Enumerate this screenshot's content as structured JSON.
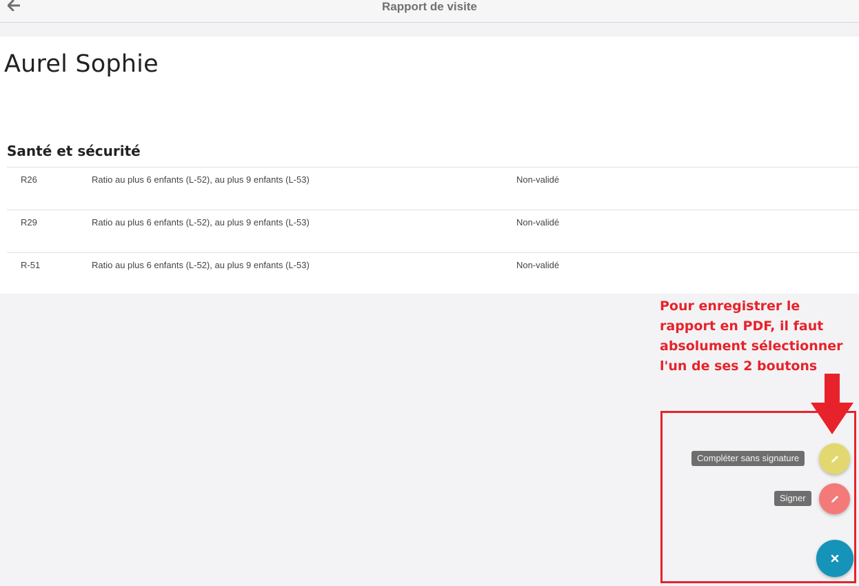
{
  "header": {
    "back_icon": "arrow-left-icon",
    "title": "Rapport de visite"
  },
  "report": {
    "person_name": "Aurel Sophie",
    "section_title": "Santé et sécurité",
    "rows": [
      {
        "code": "R26",
        "description": "Ratio au plus 6 enfants (L-52), au plus 9 enfants (L-53)",
        "status": "Non-validé"
      },
      {
        "code": "R29",
        "description": "Ratio au plus 6 enfants (L-52), au plus 9 enfants (L-53)",
        "status": "Non-validé"
      },
      {
        "code": "R-51",
        "description": "Ratio au plus 6 enfants (L-52), au plus 9 enfants (L-53)",
        "status": "Non-validé"
      }
    ]
  },
  "annotation": {
    "text": "Pour enregistrer le rapport en PDF, il faut absolument sélectionner l'un de ses 2 boutons",
    "color": "#e8222a",
    "arrow_icon": "arrow-down-icon"
  },
  "fab_menu": {
    "complete_label": "Compléter sans signature",
    "complete_icon": "pencil-icon",
    "complete_color": "#e2d86f",
    "sign_label": "Signer",
    "sign_icon": "pencil-icon",
    "sign_color": "#f47a7a",
    "close_icon": "close-icon",
    "close_color": "#1593b8"
  }
}
